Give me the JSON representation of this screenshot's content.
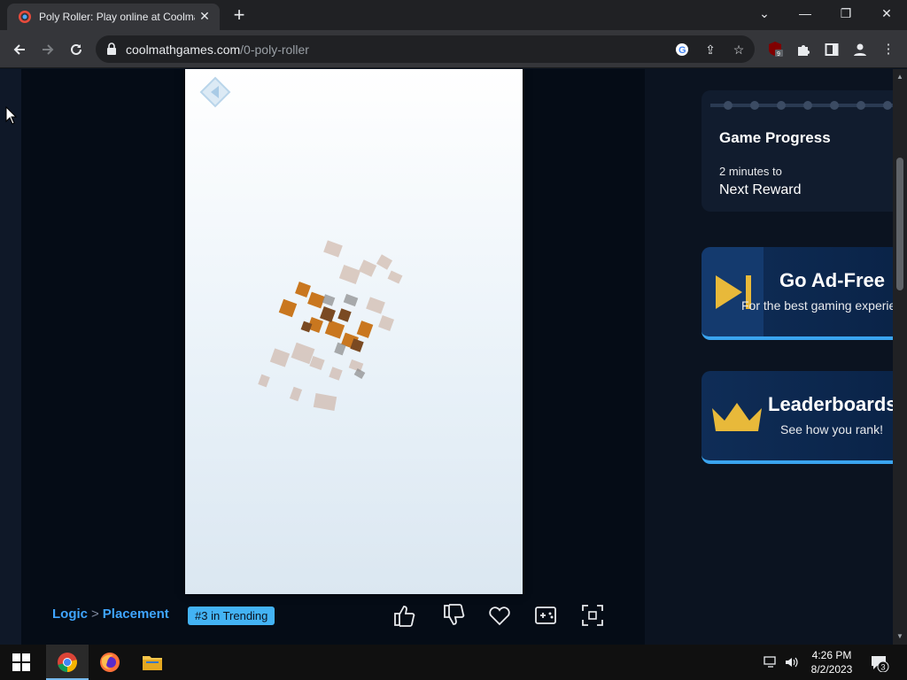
{
  "browser": {
    "tab_title": "Poly Roller: Play online at Coolmath Games",
    "tab_close": "✕",
    "new_tab": "+",
    "url_domain": "coolmathgames.com",
    "url_path": "/0-poly-roller",
    "window_controls": {
      "minimize": "—",
      "restore": "❐",
      "close": "✕",
      "tab_search": "⌄"
    },
    "extension_badge": "9"
  },
  "game": {
    "breadcrumb": {
      "category": "Logic",
      "separator": ">",
      "subcategory": "Placement"
    },
    "trending_badge": "#3 in Trending",
    "actions": [
      "thumbs-up",
      "thumbs-down",
      "favorite",
      "controller",
      "fullscreen"
    ]
  },
  "sidebar": {
    "game_progress": {
      "title": "Game Progress",
      "subtitle": "2 minutes to",
      "reward": "Next Reward"
    },
    "ad_free": {
      "title": "Go Ad-Free",
      "subtitle": "For the best gaming experience"
    },
    "leaderboards": {
      "title": "Leaderboards",
      "subtitle": "See how you rank!"
    }
  },
  "taskbar": {
    "time": "4:26 PM",
    "date": "8/2/2023",
    "notifications": "3",
    "apps": [
      "start",
      "chrome",
      "firefox",
      "file-explorer"
    ]
  },
  "colors": {
    "accent": "#3fa5ff",
    "trending_bg": "#43b3f4",
    "promo_border": "#3aa4ef",
    "gold": "#e8b93a"
  }
}
